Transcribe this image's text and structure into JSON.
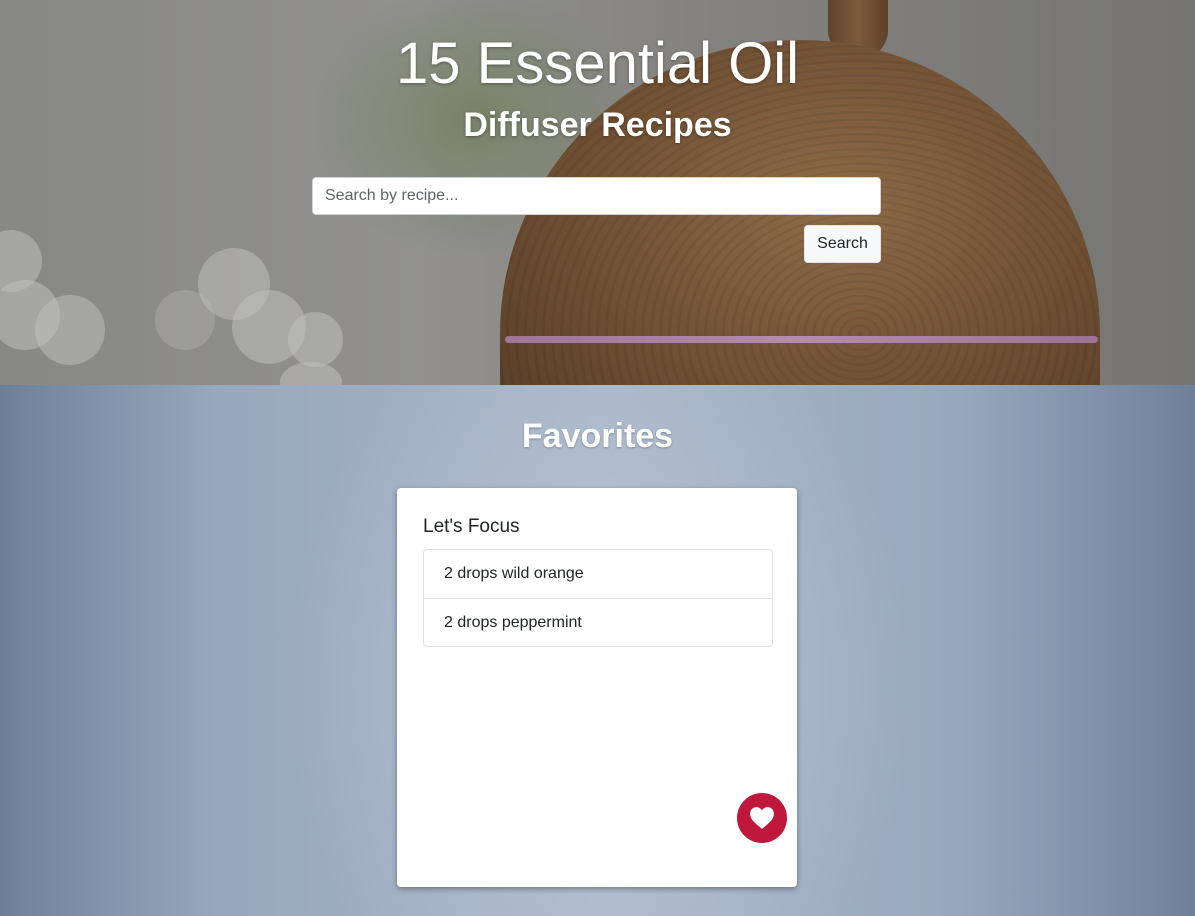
{
  "hero": {
    "title": "15 Essential Oil",
    "subtitle": "Diffuser Recipes",
    "search": {
      "placeholder": "Search by recipe...",
      "value": "",
      "button_label": "Search"
    }
  },
  "favorites": {
    "heading": "Favorites",
    "cards": [
      {
        "title": "Let's Focus",
        "ingredients": [
          "2 drops wild orange",
          "2 drops peppermint"
        ],
        "favorite_icon": "heart-icon",
        "favorited": true
      }
    ]
  },
  "colors": {
    "favorite_accent": "#c0183c",
    "button_background": "#f8f9fa"
  }
}
